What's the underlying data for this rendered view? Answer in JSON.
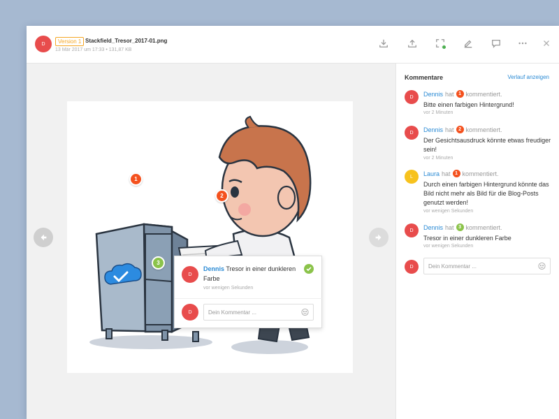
{
  "file": {
    "avatar_initial": "D",
    "version_label": "Version 1",
    "name": "Stackfield_Tresor_2017-01.png",
    "meta": "13 Mär 2017 um 17:33  •  131,87 KB"
  },
  "toolbar": {
    "icons": [
      "download-icon",
      "upload-icon",
      "fullscreen-icon",
      "edit-icon",
      "comment-icon",
      "more-icon",
      "close-icon"
    ],
    "status_color": "#4caf50"
  },
  "markers": [
    {
      "number": "1",
      "color": "#f4511e"
    },
    {
      "number": "2",
      "color": "#f4511e"
    },
    {
      "number": "3",
      "color": "#8bc34a"
    }
  ],
  "popup": {
    "author": "Dennis",
    "avatar_initial": "D",
    "text": "Tresor in einer dunkleren Farbe",
    "time": "vor wenigen Sekunden",
    "reply_avatar_initial": "D",
    "reply_placeholder": "Dein Kommentar ..."
  },
  "sidebar": {
    "title": "Kommentare",
    "history_link": "Verlauf anzeigen",
    "comments": [
      {
        "author": "Dennis",
        "initial": "D",
        "verb_pre": "hat",
        "number": "1",
        "number_color": "#f4511e",
        "verb_post": "kommentiert.",
        "text": "Bitte einen farbigen Hintergrund!",
        "time": "vor 2 Minuten",
        "avatar_color": "#e84c4c"
      },
      {
        "author": "Dennis",
        "initial": "D",
        "verb_pre": "hat",
        "number": "2",
        "number_color": "#f4511e",
        "verb_post": "kommentiert.",
        "text": "Der Gesichtsausdruck könnte etwas freudiger sein!",
        "time": "vor 2 Minuten",
        "avatar_color": "#e84c4c"
      },
      {
        "author": "Laura",
        "initial": "L",
        "verb_pre": "hat",
        "number": "1",
        "number_color": "#f4511e",
        "verb_post": "kommentiert.",
        "text": "Durch einen farbigen Hintergrund könnte das Bild nicht mehr als Bild für die Blog-Posts genutzt werden!",
        "time": "vor wenigen Sekunden",
        "avatar_color": "#f7c21d"
      },
      {
        "author": "Dennis",
        "initial": "D",
        "verb_pre": "hat",
        "number": "3",
        "number_color": "#8bc34a",
        "verb_post": "kommentiert.",
        "text": "Tresor in einer dunkleren Farbe",
        "time": "vor wenigen Sekunden",
        "avatar_color": "#e84c4c"
      }
    ],
    "input_avatar_initial": "D",
    "input_placeholder": "Dein Kommentar ..."
  }
}
